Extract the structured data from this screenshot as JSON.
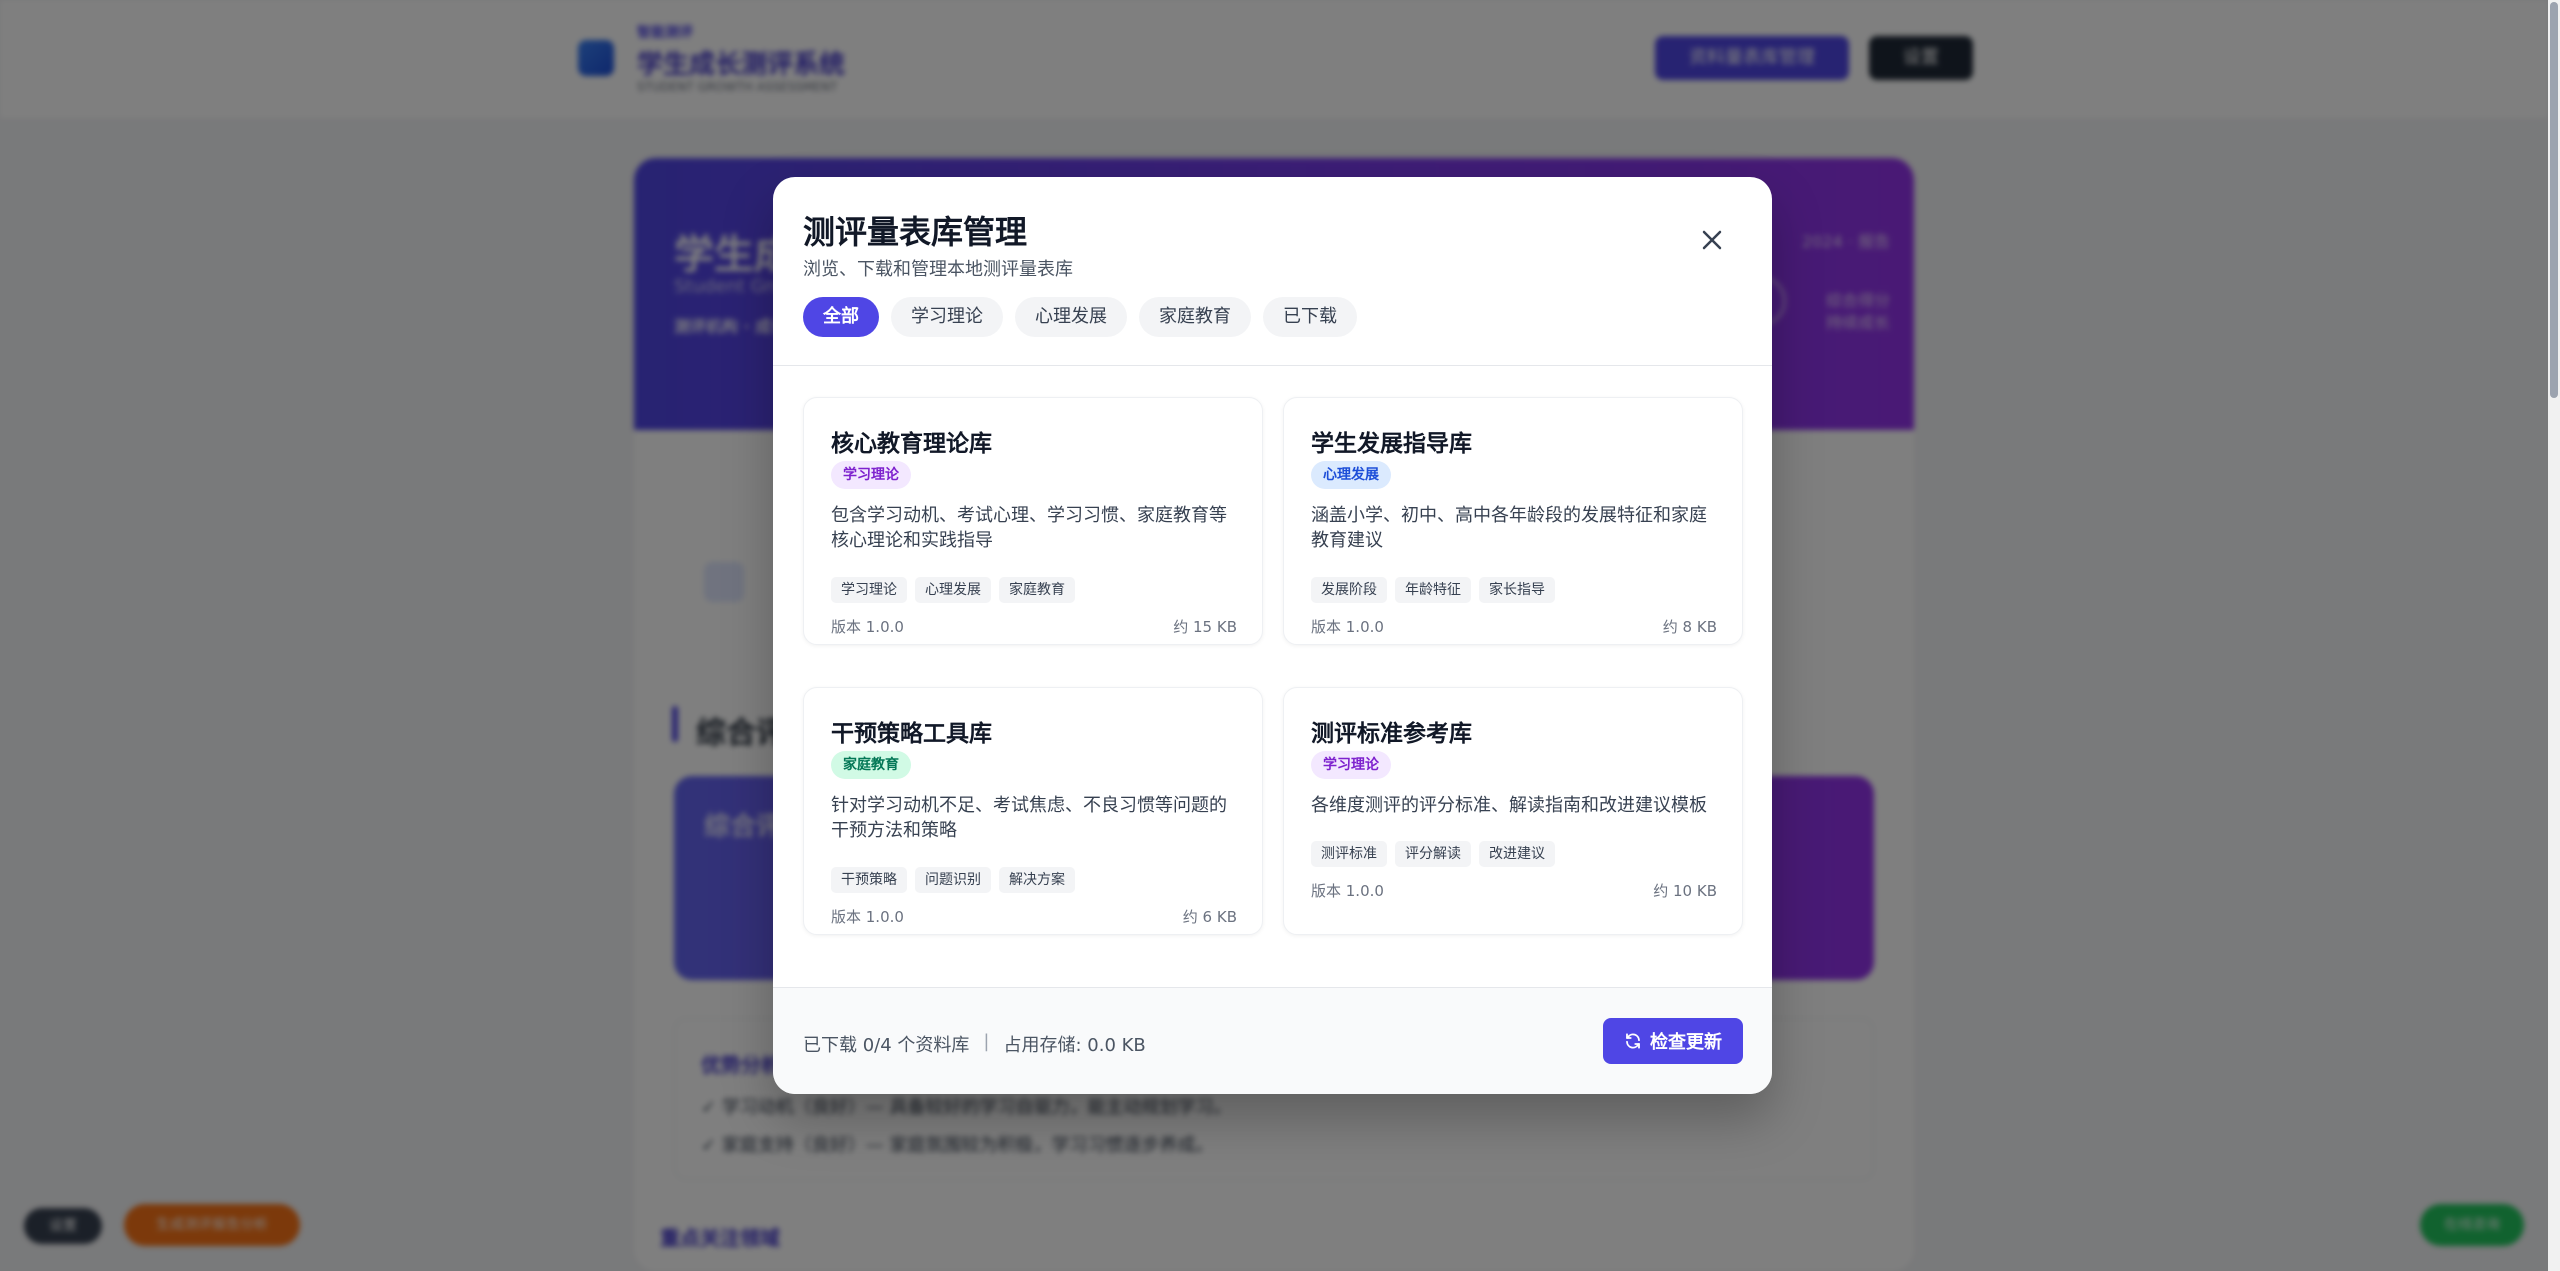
{
  "background": {
    "brand_small": "智能测评",
    "brand_title": "学生成长测评系统",
    "brand_sub": "STUDENT GROWTH ASSESSMENT",
    "primary_btn": "资料量表库管理",
    "dark_btn": "设置",
    "hero_title": "学生成长测评报告",
    "hero_sub": "Student Growth Report",
    "hero_meta": "测评机构 · 成长中心",
    "hero_right1": "2024 · 报告",
    "hero_right2_a": "综合得分",
    "hero_right2_b": "持续成长",
    "section_title": "综合评估",
    "gradient_card_text": "综合评价",
    "box1_head": "优势分析",
    "box1_line1": "✓ 学习动机（良好）— 具备较好的学习自驱力，能主动规划学习。",
    "box1_line2": "✓ 家庭支持（良好）— 家庭氛围较为积极，学习习惯逐步养成。",
    "box2_head": "重点关注领域",
    "pill_dark": "设置",
    "pill_orange": "生成测评报告分析",
    "pill_green": "在线咨询"
  },
  "modal": {
    "title": "测评量表库管理",
    "subtitle": "浏览、下载和管理本地测评量表库",
    "tabs": [
      {
        "label": "全部",
        "active": true
      },
      {
        "label": "学习理论",
        "active": false
      },
      {
        "label": "心理发展",
        "active": false
      },
      {
        "label": "家庭教育",
        "active": false
      },
      {
        "label": "已下载",
        "active": false
      }
    ],
    "cards": [
      {
        "title": "核心教育理论库",
        "badge": "学习理论",
        "desc": "包含学习动机、考试心理、学习习惯、家庭教育等核心理论和实践指导",
        "tags": [
          "学习理论",
          "心理发展",
          "家庭教育"
        ],
        "version": "版本 1.0.0",
        "size": "约 15 KB"
      },
      {
        "title": "学生发展指导库",
        "badge": "心理发展",
        "desc": "涵盖小学、初中、高中各年龄段的发展特征和家庭教育建议",
        "tags": [
          "发展阶段",
          "年龄特征",
          "家长指导"
        ],
        "version": "版本 1.0.0",
        "size": "约 8 KB"
      },
      {
        "title": "干预策略工具库",
        "badge": "家庭教育",
        "desc": "针对学习动机不足、考试焦虑、不良习惯等问题的干预方法和策略",
        "tags": [
          "干预策略",
          "问题识别",
          "解决方案"
        ],
        "version": "版本 1.0.0",
        "size": "约 6 KB"
      },
      {
        "title": "测评标准参考库",
        "badge": "学习理论",
        "desc": "各维度测评的评分标准、解读指南和改进建议模板",
        "tags": [
          "测评标准",
          "评分解读",
          "改进建议"
        ],
        "version": "版本 1.0.0",
        "size": "约 10 KB"
      }
    ],
    "footer": {
      "downloaded": "已下载 0/4 个资料库",
      "separator": "|",
      "storage": "占用存储: 0.0 KB",
      "check_btn": "检查更新"
    }
  },
  "colors": {
    "accent": "#4f46e5",
    "badge_learning_bg": "#f3e8ff",
    "badge_learning_fg": "#7e22ce",
    "badge_psych_bg": "#dbeafe",
    "badge_psych_fg": "#1d4ed8",
    "badge_family_bg": "#d1fae5",
    "badge_family_fg": "#047857"
  },
  "icons": {
    "close": "close-icon",
    "refresh": "refresh-icon"
  }
}
